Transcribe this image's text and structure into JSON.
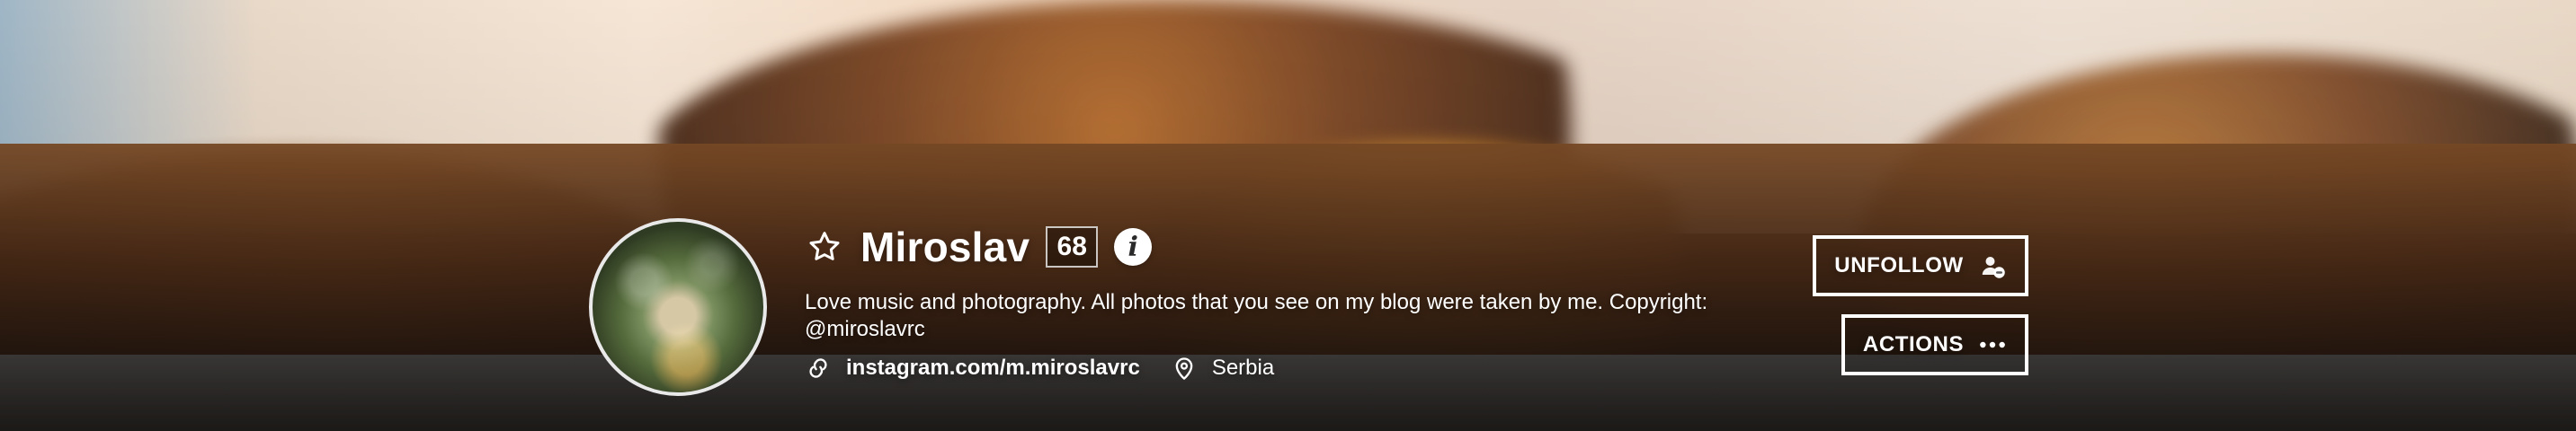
{
  "profile": {
    "name": "Miroslav",
    "score": "68",
    "bio": "Love music and photography. All photos that you see on my blog were taken by me. Copyright: @miroslavrc",
    "website": "instagram.com/m.miroslavrc",
    "location": "Serbia"
  },
  "actions": {
    "unfollow_label": "UNFOLLOW",
    "actions_label": "ACTIONS"
  },
  "icons": {
    "favorite": "star-outline-icon",
    "info": "info-icon",
    "link": "link-icon",
    "location": "location-pin-icon",
    "unfollow": "user-remove-icon",
    "more": "ellipsis-icon"
  },
  "colors": {
    "text": "#ffffff",
    "button_border": "#ffffff",
    "score_border": "#ffffff",
    "info_bg": "#ffffff"
  }
}
